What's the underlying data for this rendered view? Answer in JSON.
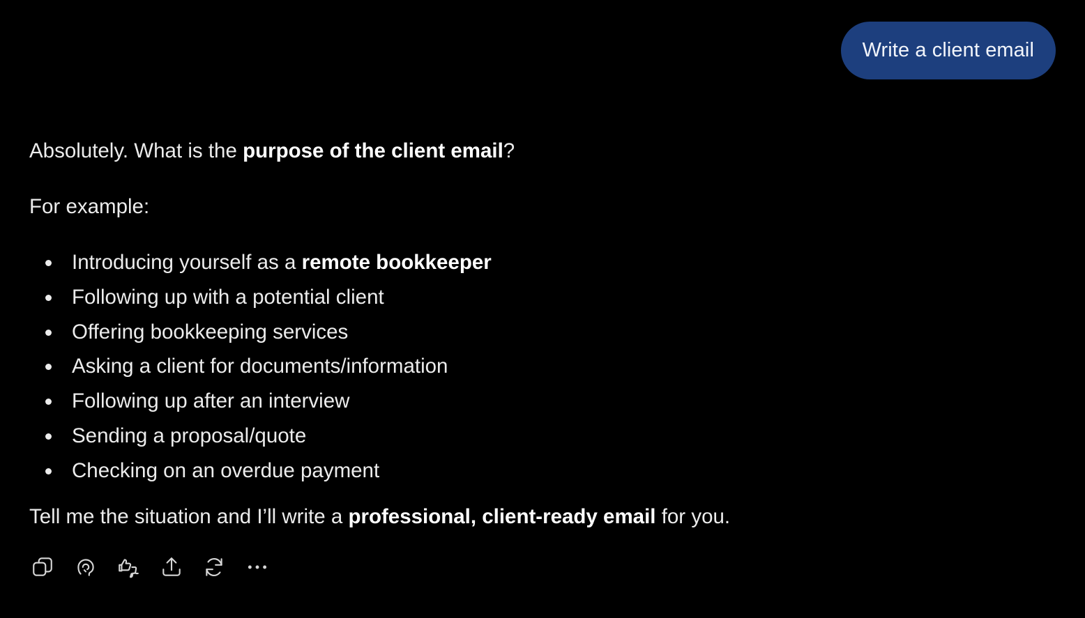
{
  "user_message": "Write a client email",
  "assistant": {
    "intro": {
      "text_before": "Absolutely. What is the ",
      "bold": "purpose of the client email",
      "text_after": "?"
    },
    "example_label": "For example:",
    "bullets": [
      {
        "text": "Introducing yourself as a ",
        "bold": "remote bookkeeper"
      },
      {
        "text": "Following up with a potential client",
        "bold": ""
      },
      {
        "text": "Offering bookkeeping services",
        "bold": ""
      },
      {
        "text": "Asking a client for documents/information",
        "bold": ""
      },
      {
        "text": "Following up after an interview",
        "bold": ""
      },
      {
        "text": "Sending a proposal/quote",
        "bold": ""
      },
      {
        "text": "Checking on an overdue payment",
        "bold": ""
      }
    ],
    "closing": {
      "text_before": "Tell me the situation and I’ll write a ",
      "bold": "professional, client-ready email",
      "text_after": " for you."
    }
  },
  "actions": [
    {
      "icon": "copy-icon"
    },
    {
      "icon": "speaker-icon"
    },
    {
      "icon": "thumbs-feedback-icon"
    },
    {
      "icon": "share-icon"
    },
    {
      "icon": "regenerate-icon"
    },
    {
      "icon": "more-icon"
    }
  ],
  "colors": {
    "background": "#000000",
    "user_bubble": "#1d3f7e",
    "text": "#ececec"
  }
}
